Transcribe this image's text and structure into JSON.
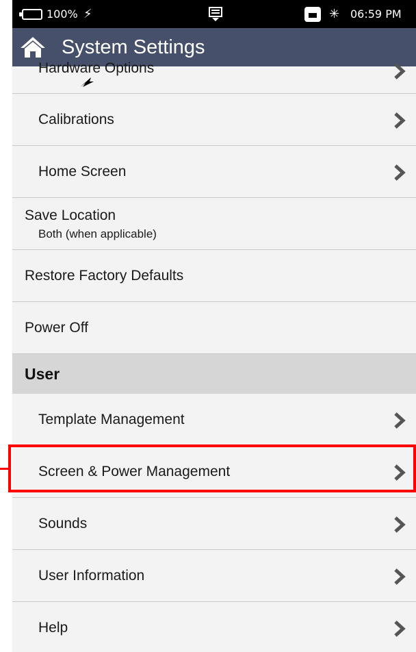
{
  "status_bar": {
    "battery_icon": "battery-icon",
    "battery_percent": "100%",
    "charging_icon": "lightning-icon",
    "usb_icon": "usb-icon",
    "ethernet_icon": "ethernet-icon",
    "bluetooth_icon": "bluetooth-icon",
    "time": "06:59 PM"
  },
  "header": {
    "home_icon": "home-icon",
    "title": "System Settings",
    "background": "#47506a"
  },
  "items": [
    {
      "label": "Hardware Options",
      "chevron": true
    },
    {
      "label": "Calibrations",
      "chevron": true
    },
    {
      "label": "Home Screen",
      "chevron": true
    },
    {
      "label": "Save Location",
      "sublabel": "Both (when applicable)",
      "chevron": false
    },
    {
      "label": "Restore Factory Defaults",
      "chevron": false
    },
    {
      "label": "Power Off",
      "chevron": false
    }
  ],
  "section": {
    "label": "User"
  },
  "user_items": [
    {
      "label": "Template Management",
      "chevron": true
    },
    {
      "label": "Screen & Power Management",
      "chevron": true,
      "highlighted": true
    },
    {
      "label": "Sounds",
      "chevron": true
    },
    {
      "label": "User Information",
      "chevron": true
    },
    {
      "label": "Help",
      "chevron": true
    }
  ],
  "highlight_color": "#ff0000"
}
